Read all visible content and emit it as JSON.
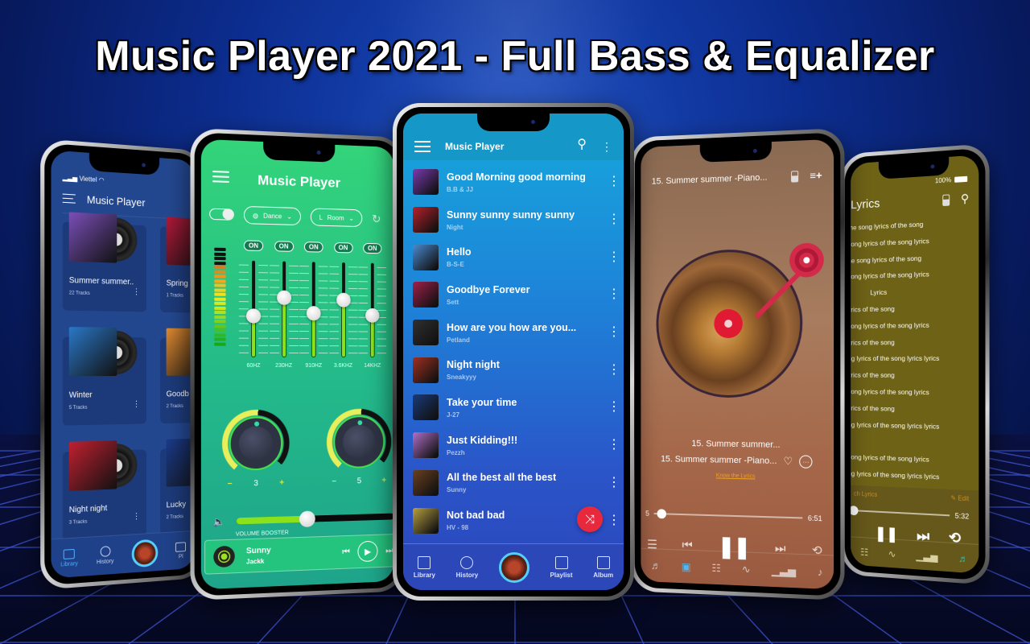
{
  "headline": "Music Player 2021 - Full Bass & Equalizer",
  "library_screen": {
    "carrier": "Viettel",
    "title": "Music Player",
    "albums": [
      {
        "name": "Summer summer..",
        "tracks": "22 Tracks",
        "art_color": "#7a4fb8"
      },
      {
        "name": "Spring",
        "tracks": "1 Tracks",
        "art_color": "#b01838"
      },
      {
        "name": "Winter",
        "tracks": "5 Tracks",
        "art_color": "#2a78c8"
      },
      {
        "name": "Goodb",
        "tracks": "2 Tracks",
        "art_color": "#e08a30"
      },
      {
        "name": "Night night",
        "tracks": "3 Tracks",
        "art_color": "#c02030"
      },
      {
        "name": "Lucky",
        "tracks": "2 Tracks",
        "art_color": "#1a3a8a"
      }
    ],
    "nav": [
      {
        "label": "Library",
        "icon": "folder-play-icon",
        "active": true
      },
      {
        "label": "History",
        "icon": "clock-icon",
        "active": false
      },
      {
        "label": "",
        "icon": "now-playing-disc",
        "active": false
      },
      {
        "label": "Pl",
        "icon": "playlist-icon",
        "active": false
      }
    ]
  },
  "equalizer_screen": {
    "title": "Music Player",
    "preset": "Dance",
    "reverb_prefix": "L",
    "reverb": "Room",
    "bands": [
      {
        "freq": "60HZ",
        "state": "ON",
        "level": 0.42
      },
      {
        "freq": "230HZ",
        "state": "ON",
        "level": 0.62
      },
      {
        "freq": "910HZ",
        "state": "ON",
        "level": 0.46
      },
      {
        "freq": "3.6KHZ",
        "state": "ON",
        "level": 0.6
      },
      {
        "freq": "14KHZ",
        "state": "ON",
        "level": 0.44
      }
    ],
    "knobs": [
      {
        "value": "3",
        "minus": "−",
        "plus": "+"
      },
      {
        "value": "5",
        "minus": "−",
        "plus": "+"
      }
    ],
    "volume_label": "VOLUME BOOSTER",
    "volume_level": 0.44,
    "mini_player": {
      "title": "Sunny",
      "artist": "Jackk"
    }
  },
  "list_screen": {
    "title": "Music Player",
    "songs": [
      {
        "title": "Good Morning good morning",
        "artist": "B.B & JJ",
        "art_color": "#7a3ab0"
      },
      {
        "title": "Sunny sunny sunny sunny",
        "artist": "Night",
        "art_color": "#b8202a"
      },
      {
        "title": "Hello",
        "artist": "B-S-E",
        "art_color": "#4a8ad0"
      },
      {
        "title": "Goodbye Forever",
        "artist": "Sett",
        "art_color": "#a0204a"
      },
      {
        "title": "How are you how are you...",
        "artist": "Petland",
        "art_color": "#303030"
      },
      {
        "title": "Night night",
        "artist": "Sneakyyy",
        "art_color": "#a03020"
      },
      {
        "title": "Take your time",
        "artist": "J-27",
        "art_color": "#1a3a7a"
      },
      {
        "title": "Just Kidding!!!",
        "artist": "Pezzh",
        "art_color": "#b070c8"
      },
      {
        "title": "All the best all the best",
        "artist": "Sunny",
        "art_color": "#6a4020"
      },
      {
        "title": "Not bad bad",
        "artist": "HV - 98",
        "art_color": "#b8a040"
      }
    ],
    "nav": [
      {
        "label": "Library",
        "icon": "folder-play-icon"
      },
      {
        "label": "History",
        "icon": "alarm-clock-icon"
      },
      {
        "label": "",
        "icon": "now-playing-disc"
      },
      {
        "label": "Playlist",
        "icon": "playlist-icon"
      },
      {
        "label": "Album",
        "icon": "album-icon"
      }
    ]
  },
  "now_playing_screen": {
    "header_title": "15. Summer summer -Piano...",
    "line1": "15. Summer summer...",
    "line2": "15. Summer summer -Piano...",
    "lyrics_link": "Know the Lyrics",
    "elapsed": "5",
    "duration": "6:51",
    "progress": 0.02
  },
  "lyrics_screen": {
    "battery": "100%",
    "title": "Lyrics",
    "lines": [
      "the song lyrics of the song",
      "song lyrics of the song lyrics",
      "he song lyrics of the song",
      "song lyrics of the song lyrics",
      "Lyrics",
      "yrics of the song",
      "song lyrics of the song lyrics",
      "yrics of the song",
      "ng lyrics of the song lyrics lyrics",
      "yrics of the song",
      "song lyrics of the song lyrics",
      "yrics of the song",
      "ng lyrics of the song lyrics lyrics",
      "",
      "song lyrics of the song lyrics",
      "ng lyrics of the song lyrics lyrics"
    ],
    "search_lyrics": "ch Lyrics",
    "edit": "Edit",
    "duration": "5:32",
    "progress": 0.0
  }
}
